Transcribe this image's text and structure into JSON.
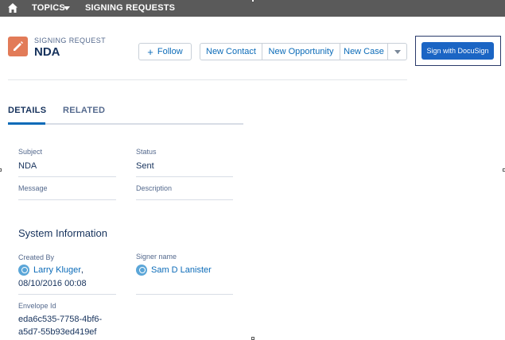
{
  "topnav": {
    "home_icon": "home-icon",
    "topics_label": "TOPICS",
    "topics_icon": "caret-down-icon",
    "signing_requests_label": "SIGNING REQUESTS"
  },
  "record": {
    "icon": "pencil-icon",
    "icon_color": "#e27b58",
    "type_label": "SIGNING REQUEST",
    "title": "NDA"
  },
  "actions": {
    "follow_label": "Follow",
    "follow_icon": "plus-icon",
    "group_buttons": [
      "New Contact",
      "New Opportunity",
      "New Case"
    ],
    "more_icon": "chevron-down-icon",
    "docusign_label": "Sign with DocuSign",
    "docusign_color": "#1b65c4"
  },
  "tabs": [
    {
      "label": "DETAILS",
      "active": true
    },
    {
      "label": "RELATED",
      "active": false
    }
  ],
  "details": {
    "subject_label": "Subject",
    "subject_value": "NDA",
    "status_label": "Status",
    "status_value": "Sent",
    "message_label": "Message",
    "description_label": "Description"
  },
  "system_info": {
    "title": "System Information",
    "created_by_label": "Created By",
    "created_by_name": "Larry Kluger",
    "created_by_suffix": ",",
    "created_date": "08/10/2016 00:08",
    "signer_label": "Signer name",
    "signer_name": "Sam D Lanister",
    "user_icon": "user-icon",
    "envelope_label": "Envelope Id",
    "envelope_line1": "eda6c535-7758-4bf6-",
    "envelope_line2": "a5d7-55b93ed419ef"
  },
  "colors": {
    "link": "#0b6bb8",
    "text": "#16325c",
    "label": "#54698d",
    "nav_bg": "#5a5a5a"
  }
}
